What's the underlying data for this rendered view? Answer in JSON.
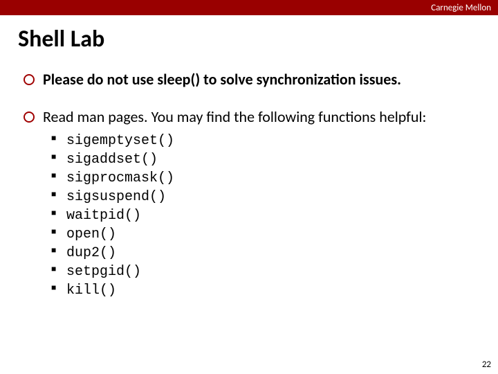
{
  "banner": {
    "org": "Carnegie Mellon"
  },
  "title": "Shell Lab",
  "bullets": [
    {
      "text": "Please do not use sleep() to solve synchronization issues.",
      "bold": true
    },
    {
      "text": "Read man pages. You may find the following functions helpful:",
      "bold": false
    }
  ],
  "functions": [
    "sigemptyset()",
    "sigaddset()",
    "sigprocmask()",
    "sigsuspend()",
    "waitpid()",
    "open()",
    "dup2()",
    "setpgid()",
    "kill()"
  ],
  "page_number": "22"
}
